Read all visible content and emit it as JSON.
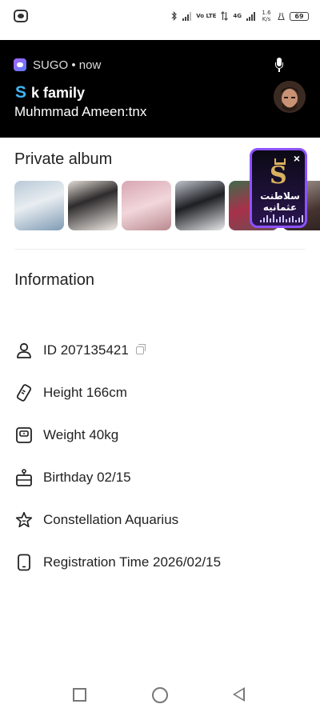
{
  "status_bar": {
    "network_label": "Vo LTE",
    "network_gen": "4G",
    "speed": "1.6 K/s",
    "battery": "69"
  },
  "notification": {
    "app_name": "SUGO • now",
    "title": "k family",
    "title_logo": "S",
    "message": "Muhmmad Ameen:tnx",
    "brand_color": "#3fb7f5"
  },
  "album": {
    "title": "Private album",
    "photo_count": 6
  },
  "bubble": {
    "logo_letter": "S",
    "arabic_text": "سلاطنت عثمانیه",
    "close_label": "×",
    "border_color": "#8e52ff"
  },
  "information": {
    "title": "Information",
    "id_label": "ID 207135421",
    "height_label": "Height 166cm",
    "weight_label": "Weight 40kg",
    "birthday_label": "Birthday 02/15",
    "constellation_label": "Constellation Aquarius",
    "registration_label": "Registration Time 2026/02/15"
  },
  "icons": {
    "status_left": "app-notification-icon",
    "mic": "microphone-icon",
    "id": "person-icon",
    "height": "ruler-icon",
    "weight": "scale-icon",
    "birthday": "cake-icon",
    "constellation": "star-icon",
    "registration": "phone-icon"
  }
}
